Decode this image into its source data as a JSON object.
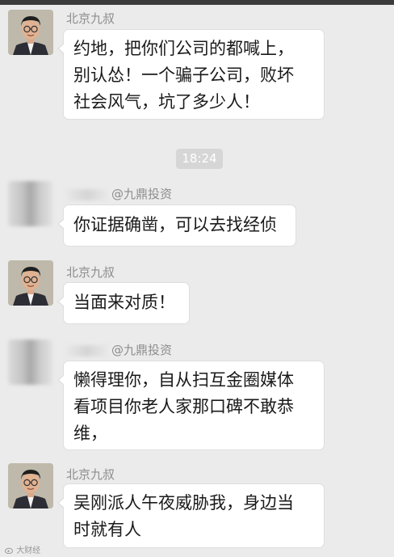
{
  "timestamp": "18:24",
  "messages": [
    {
      "sender": "北京九叔",
      "text": "约地，把你们公司的都喊上，\n别认怂！一个骗子公司，败坏\n社会风气，坑了多少人！"
    },
    {
      "sender": "@九鼎投资",
      "text": "你证据确凿，可以去找经侦"
    },
    {
      "sender": "北京九叔",
      "text": "当面来对质！"
    },
    {
      "sender": "@九鼎投资",
      "text": "懒得理你，自从扫互金圈媒体\n看项目你老人家那口碑不敢恭\n维，"
    },
    {
      "sender": "北京九叔",
      "text": "吴刚派人午夜威胁我，身边当\n时就有人"
    }
  ],
  "watermark": "大财经"
}
